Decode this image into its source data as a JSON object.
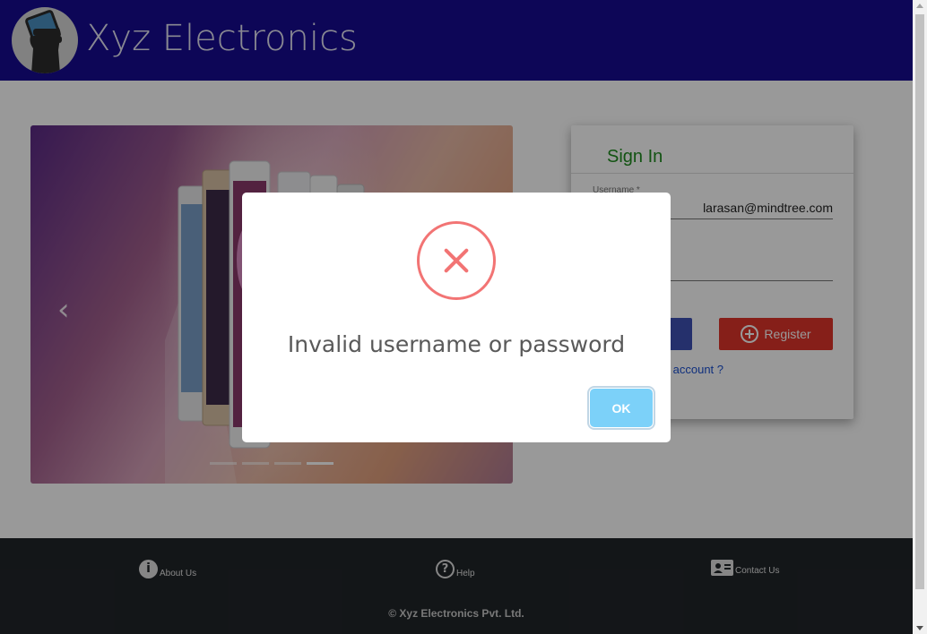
{
  "header": {
    "brand": "Xyz Electronics"
  },
  "carousel": {
    "prev_icon": "chevron-left-icon",
    "indicator_count": 4,
    "active_indicator": 4
  },
  "signin": {
    "title": "Sign In",
    "username_label": "Username *",
    "username_value": "larasan@mindtree.com",
    "register_label": "Register",
    "forgot_text": "account ?"
  },
  "footer": {
    "about": "About Us",
    "help": "Help",
    "contact": "Contact Us",
    "copyright": "© Xyz Electronics Pvt. Ltd."
  },
  "modal": {
    "icon": "error-x-icon",
    "message": "Invalid username or password",
    "ok_label": "OK"
  },
  "colors": {
    "header_bg": "#170a92",
    "footer_bg": "#212529",
    "register_bg": "#e0342b",
    "signin_title": "#1f8a1f",
    "error_icon": "#f27474",
    "ok_button": "#7cd1f9"
  }
}
